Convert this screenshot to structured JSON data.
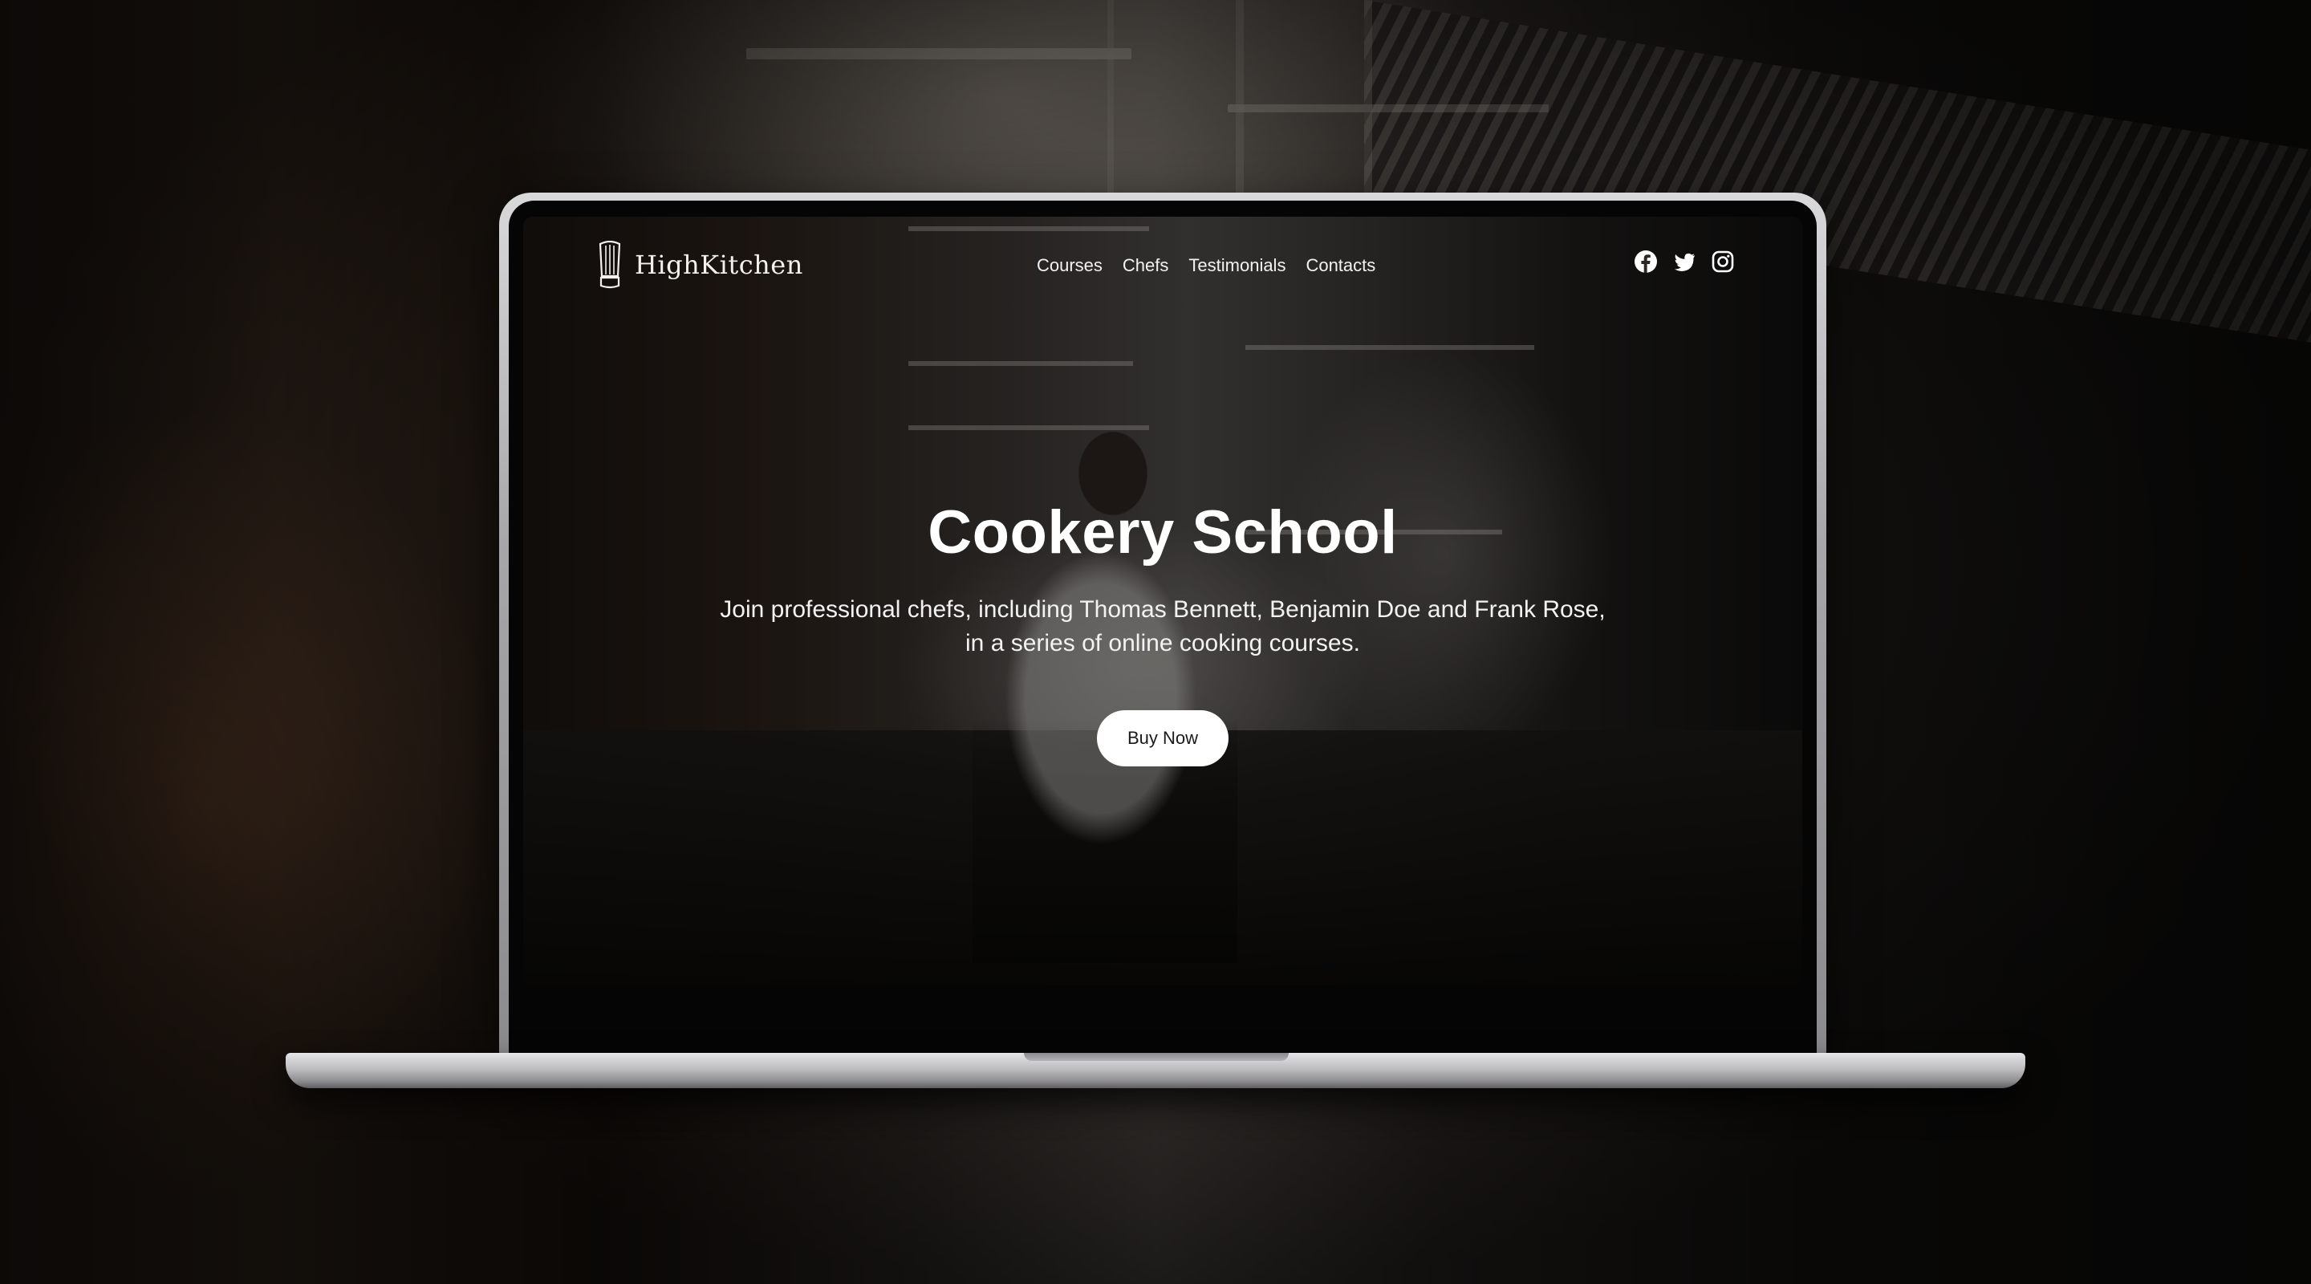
{
  "site": {
    "logo_text": "HighKitchen",
    "logo_icon": "chef-hat-icon",
    "nav": [
      {
        "label": "Courses"
      },
      {
        "label": "Chefs"
      },
      {
        "label": "Testimonials"
      },
      {
        "label": "Contacts"
      }
    ],
    "social": [
      {
        "icon": "facebook-icon"
      },
      {
        "icon": "twitter-icon"
      },
      {
        "icon": "instagram-icon"
      }
    ]
  },
  "hero": {
    "title": "Cookery School",
    "description_line1": "Join professional chefs, including Thomas Bennett, Benjamin Doe and Frank Rose,",
    "description_line2": "in a series of online cooking courses.",
    "cta_label": "Buy Now"
  },
  "colors": {
    "text": "#ffffff",
    "button_bg": "#ffffff",
    "button_text": "#1a1a1a",
    "background": "#0c0907"
  }
}
